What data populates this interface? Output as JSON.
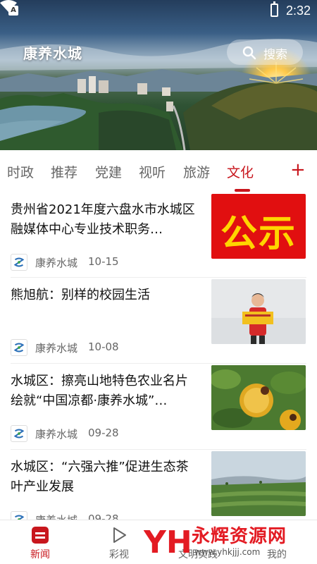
{
  "status_bar": {
    "time": "2:32"
  },
  "header": {
    "app_title": "康养水城",
    "search_label": "搜索"
  },
  "tabs": [
    {
      "label": "时政",
      "active": false
    },
    {
      "label": "推荐",
      "active": false
    },
    {
      "label": "党建",
      "active": false
    },
    {
      "label": "视听",
      "active": false
    },
    {
      "label": "旅游",
      "active": false
    },
    {
      "label": "文化",
      "active": true
    }
  ],
  "tab_add_label": "+",
  "news": [
    {
      "title": "贵州省2021年度六盘水市水城区融媒体中心专业技术职务…",
      "source": "康养水城",
      "date": "10-15",
      "thumb_text": "公示"
    },
    {
      "title": "熊旭航：别样的校园生活",
      "source": "康养水城",
      "date": "10-08"
    },
    {
      "title": "水城区：擦亮山地特色农业名片 绘就“中国凉都·康养水城”…",
      "source": "康养水城",
      "date": "09-28"
    },
    {
      "title": "水城区：“六强六推”促进生态茶叶产业发展",
      "source": "康养水城",
      "date": "09-28"
    }
  ],
  "bottom_nav": [
    {
      "label": "新闻",
      "active": true
    },
    {
      "label": "彩视",
      "active": false
    },
    {
      "label": "文明实践",
      "active": false
    },
    {
      "label": "我的",
      "active": false
    }
  ],
  "watermark": {
    "text": "永辉资源网",
    "url": "www.yhkjjj.com"
  },
  "colors": {
    "accent": "#c8161d"
  }
}
